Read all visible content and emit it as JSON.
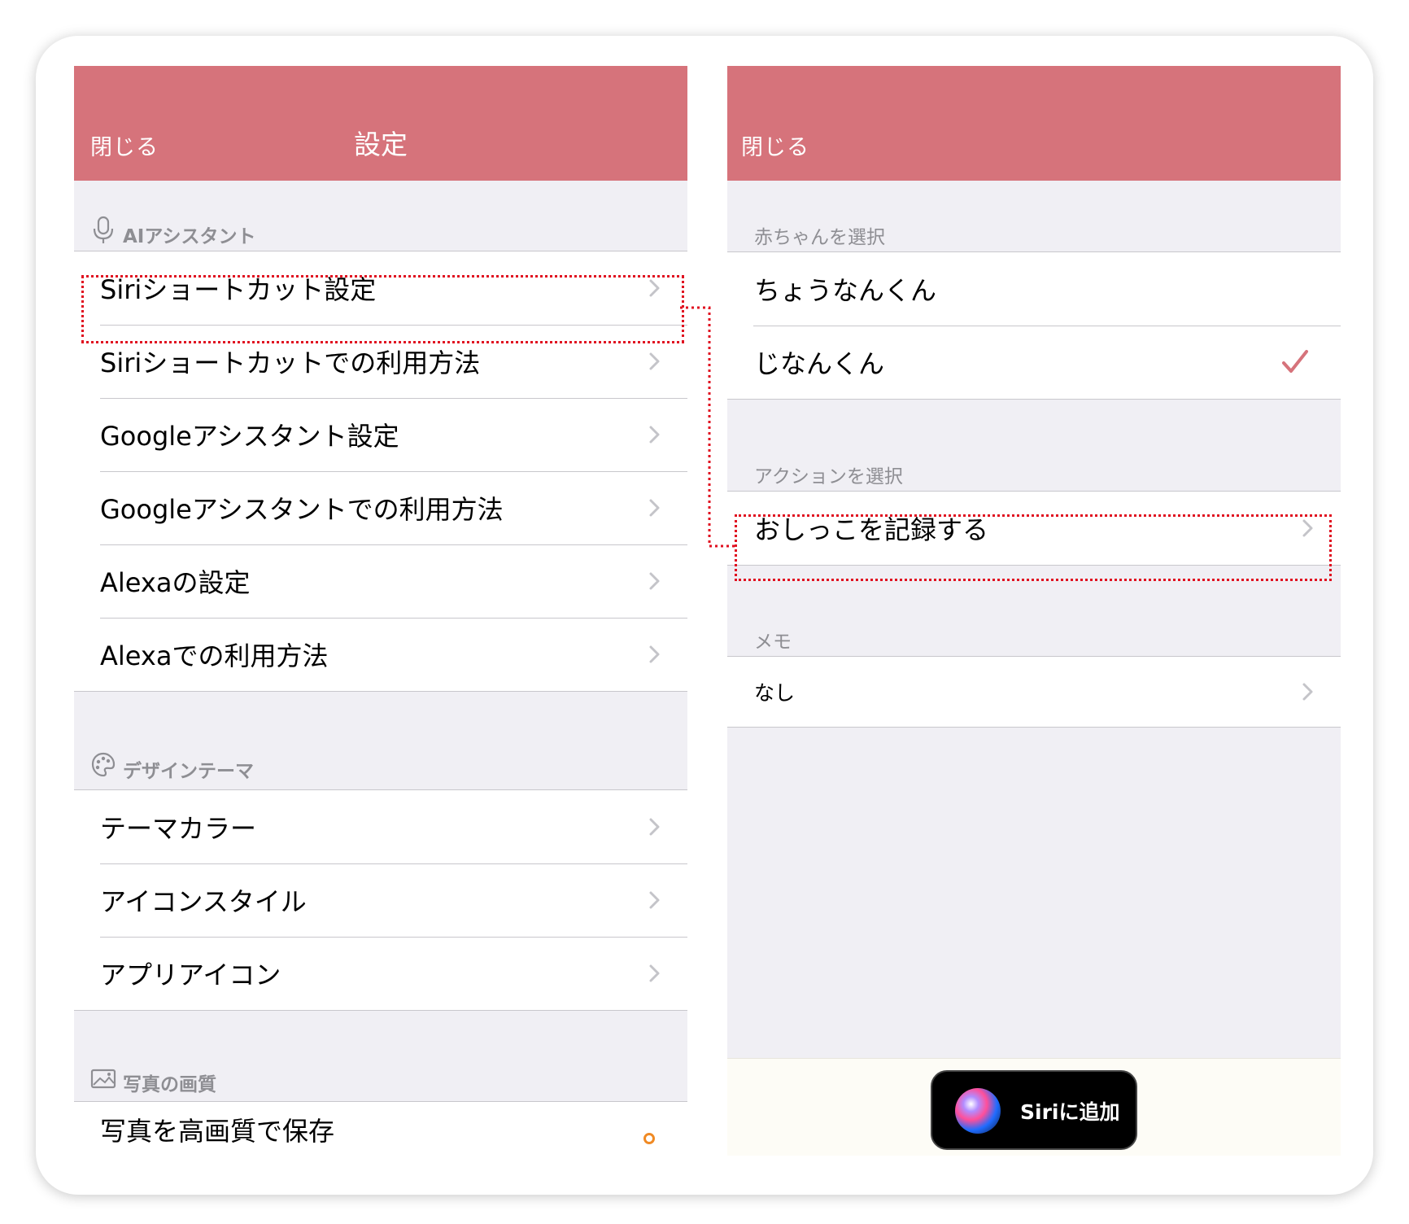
{
  "left_panel": {
    "nav": {
      "close_label": "閉じる",
      "title": "設定"
    },
    "sections": [
      {
        "header": "AIアシスタント",
        "icon": "microphone-icon",
        "items": [
          {
            "label": "Siriショートカット設定"
          },
          {
            "label": "Siriショートカットでの利用方法"
          },
          {
            "label": "Googleアシスタント設定"
          },
          {
            "label": "Googleアシスタントでの利用方法"
          },
          {
            "label": "Alexaの設定"
          },
          {
            "label": "Alexaでの利用方法"
          }
        ]
      },
      {
        "header": "デザインテーマ",
        "icon": "palette-icon",
        "items": [
          {
            "label": "テーマカラー"
          },
          {
            "label": "アイコンスタイル"
          },
          {
            "label": "アプリアイコン"
          }
        ]
      },
      {
        "header": "写真の画質",
        "icon": "photo-icon",
        "items": [
          {
            "label": "写真を高画質で保存"
          }
        ]
      }
    ]
  },
  "right_panel": {
    "nav": {
      "close_label": "閉じる"
    },
    "baby_section": {
      "header": "赤ちゃんを選択",
      "items": [
        {
          "label": "ちょうなんくん",
          "selected": false
        },
        {
          "label": "じなんくん",
          "selected": true
        }
      ]
    },
    "action_section": {
      "header": "アクションを選択",
      "items": [
        {
          "label": "おしっこを記録する"
        }
      ]
    },
    "memo_section": {
      "header": "メモ",
      "items": [
        {
          "label": "なし"
        }
      ]
    },
    "siri_button": {
      "label": "Siriに追加"
    }
  },
  "colors": {
    "nav_bar": "#d6737b",
    "checkmark": "#d6737b",
    "highlight_dash": "#e01020",
    "background": "#f0eff4",
    "toggle_accent": "#f08a24"
  }
}
